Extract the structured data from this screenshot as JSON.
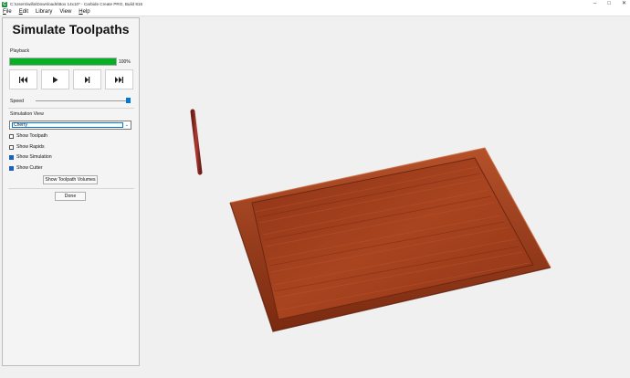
{
  "window": {
    "title": "C:\\Users\\willa\\Downloads\\Box 14x10* - Carbide Create PRO, Build 815",
    "icon": "carbide-create-icon"
  },
  "menu": {
    "file": {
      "hot": "F",
      "rest": "ile"
    },
    "edit": {
      "hot": "E",
      "rest": "dit"
    },
    "library": {
      "text": "Library"
    },
    "view": {
      "text": "View"
    },
    "help": {
      "hot": "H",
      "rest": "elp"
    }
  },
  "panel": {
    "title": "Simulate Toolpaths",
    "playback_label": "Playback",
    "progress": 100,
    "progress_text": "100%",
    "speed_label": "Speed",
    "speed_value": 1.0,
    "sim_view_label": "Simulation View",
    "sim_view_value": "Cherry",
    "checkboxes": {
      "show_toolpath": {
        "label": "Show Toolpath",
        "checked": false
      },
      "show_rapids": {
        "label": "Show Rapids",
        "checked": false
      },
      "show_simulation": {
        "label": "Show Simulation",
        "checked": true
      },
      "show_cutter": {
        "label": "Show Cutter",
        "checked": true
      }
    },
    "volumes_button": "Show Toolpath Volumes",
    "done_button": "Done"
  },
  "icons": [
    "skip-back-icon",
    "play-icon",
    "step-forward-icon",
    "skip-end-icon",
    "minimize-icon",
    "maximize-icon",
    "close-icon",
    "chevron-down-icon"
  ],
  "colors": {
    "progress": "#06b025",
    "accent": "#0078d7",
    "wood": "#a8401d"
  }
}
